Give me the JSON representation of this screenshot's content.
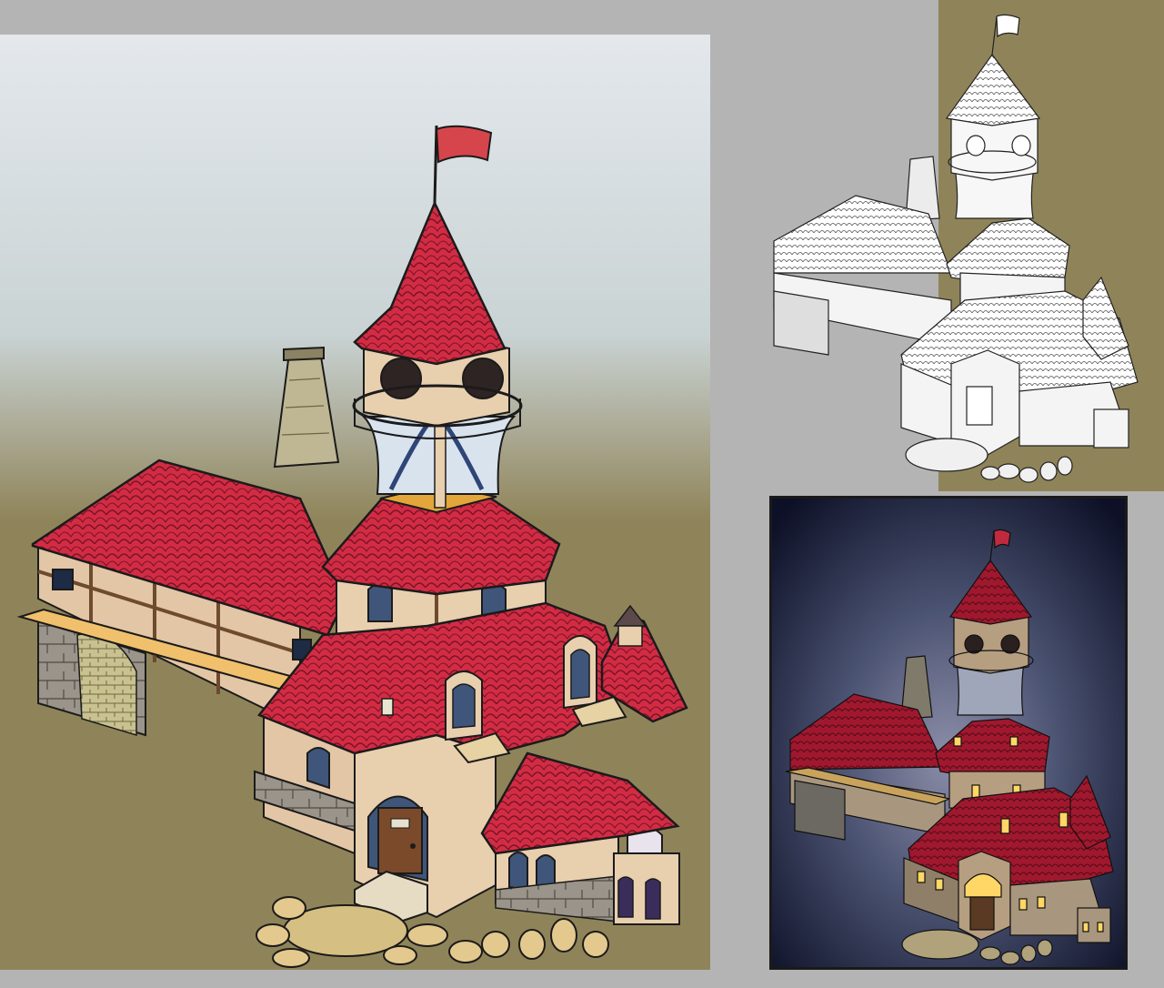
{
  "colors": {
    "page_background": "#b4b4b4",
    "sky_top": "#dfe6ea",
    "sky_mid": "#c3cdc8",
    "ground": "#8f8459",
    "roof_red": "#d22c44",
    "roof_dark": "#8e1a2b",
    "wall_cream": "#e8cfae",
    "timber": "#7a5638",
    "stone": "#9b958c",
    "bridge": "#f1c06c",
    "night_top": "#0d1026",
    "night_glow": "#3c4566",
    "window_glow": "#ffd766",
    "lineart_bg": "#b4b4b4",
    "lineart_strip": "#8f8459"
  },
  "panels": [
    {
      "id": "main",
      "style": "colored-day"
    },
    {
      "id": "lineart",
      "style": "line-art"
    },
    {
      "id": "night",
      "style": "colored-night"
    }
  ]
}
